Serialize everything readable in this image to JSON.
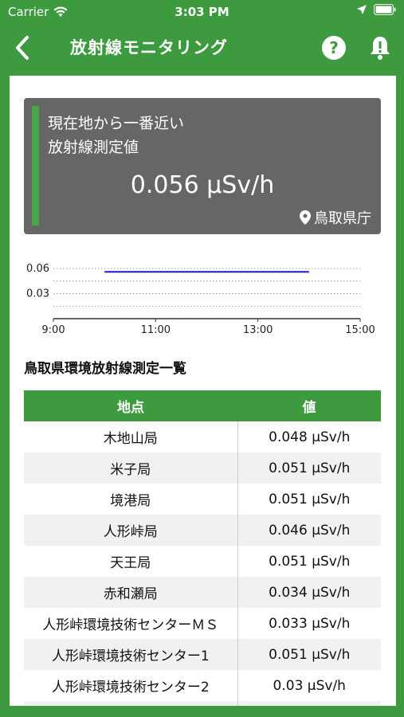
{
  "status_bar": {
    "carrier": "Carrier",
    "time": "3:03 PM"
  },
  "nav": {
    "title": "放射線モニタリング",
    "back_icon": "chevron-left-icon",
    "help_icon": "question-icon",
    "bell_icon": "bell-alert-icon"
  },
  "card": {
    "label_line1": "現在地から一番近い",
    "label_line2": "放射線測定値",
    "value": "0.056 μSv/h",
    "location": "鳥取県庁"
  },
  "chart_data": {
    "type": "line",
    "y_ticks": [
      "0.06",
      "0.03"
    ],
    "x_ticks": [
      "9:00",
      "11:00",
      "13:00",
      "15:00"
    ],
    "ylim": [
      0,
      0.06
    ],
    "xlim": [
      "9:00",
      "15:00"
    ],
    "series": [
      {
        "x": [
          "10:00",
          "14:00"
        ],
        "values": [
          0.056,
          0.056
        ]
      }
    ]
  },
  "section_title": "鳥取県環境放射線測定一覧",
  "table": {
    "headers": [
      "地点",
      "値"
    ],
    "rows": [
      [
        "木地山局",
        "0.048 μSv/h"
      ],
      [
        "米子局",
        "0.051 μSv/h"
      ],
      [
        "境港局",
        "0.051 μSv/h"
      ],
      [
        "人形峠局",
        "0.046 μSv/h"
      ],
      [
        "天王局",
        "0.051 μSv/h"
      ],
      [
        "赤和瀬局",
        "0.034 μSv/h"
      ],
      [
        "人形峠環境技術センターＭＳ",
        "0.033 μSv/h"
      ],
      [
        "人形峠環境技術センター1",
        "0.051 μSv/h"
      ],
      [
        "人形峠環境技術センター2",
        "0.03 μSv/h"
      ]
    ]
  },
  "colors": {
    "brand_green": "#3e9a3e",
    "card_gray": "#666666",
    "line_blue": "#1a1ad6"
  }
}
